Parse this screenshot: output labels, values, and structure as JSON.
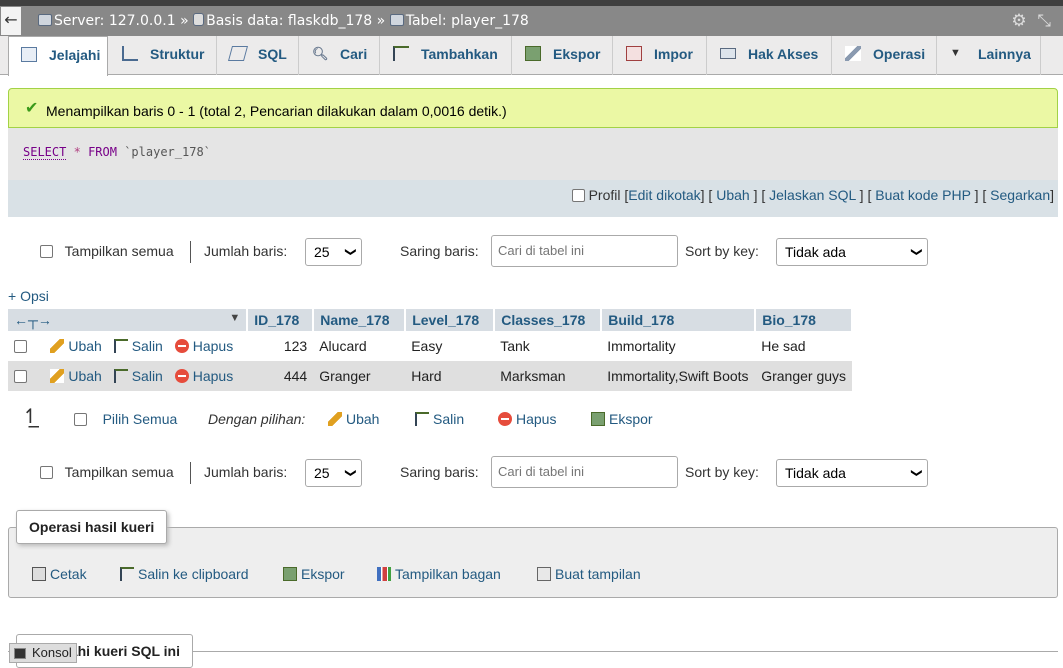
{
  "breadcrumb": {
    "server": "Server: 127.0.0.1",
    "database": "Basis data: flaskdb_178",
    "table": "Tabel: player_178",
    "separator": "»"
  },
  "tabs": [
    {
      "label": "Jelajahi",
      "icon": "browse-icon",
      "active": true
    },
    {
      "label": "Struktur",
      "icon": "structure-icon"
    },
    {
      "label": "SQL",
      "icon": "sql-icon"
    },
    {
      "label": "Cari",
      "icon": "search-icon"
    },
    {
      "label": "Tambahkan",
      "icon": "insert-icon"
    },
    {
      "label": "Ekspor",
      "icon": "export-icon"
    },
    {
      "label": "Impor",
      "icon": "import-icon"
    },
    {
      "label": "Hak Akses",
      "icon": "privileges-icon"
    },
    {
      "label": "Operasi",
      "icon": "wrench-icon"
    },
    {
      "label": "Lainnya",
      "icon": "caret-down-icon"
    }
  ],
  "message": "Menampilkan baris 0 - 1 (total 2, Pencarian dilakukan dalam 0,0016 detik.)",
  "sql": {
    "select": "SELECT",
    "star": "*",
    "from": "FROM",
    "table": "`player_178`"
  },
  "sql_links": {
    "profil": "Profil",
    "edit_inline": "Edit dikotak",
    "ubah": "Ubah",
    "jelaskan": "Jelaskan SQL",
    "buat_kode": "Buat kode PHP",
    "segarkan": "Segarkan"
  },
  "nav": {
    "show_all": "Tampilkan semua",
    "rows_label": "Jumlah baris:",
    "rows_value": "25",
    "filter_label": "Saring baris:",
    "filter_placeholder": "Cari di tabel ini",
    "sort_label": "Sort by key:",
    "sort_value": "Tidak ada"
  },
  "opsi": "+ Opsi",
  "table": {
    "columns": [
      "ID_178",
      "Name_178",
      "Level_178",
      "Classes_178",
      "Build_178",
      "Bio_178"
    ],
    "row_actions": {
      "edit": "Ubah",
      "copy": "Salin",
      "delete": "Hapus"
    },
    "rows": [
      [
        "123",
        "Alucard",
        "Easy",
        "Tank",
        "Immortality",
        "He sad"
      ],
      [
        "444",
        "Granger",
        "Hard",
        "Marksman",
        "Immortality,Swift Boots",
        "Granger guys"
      ]
    ]
  },
  "bulk": {
    "select_all": "Pilih Semua",
    "with_selected": "Dengan pilihan:",
    "edit": "Ubah",
    "copy": "Salin",
    "delete": "Hapus",
    "export": "Ekspor"
  },
  "query_ops": {
    "legend": "Operasi hasil kueri",
    "print": "Cetak",
    "copy_clipboard": "Salin ke clipboard",
    "export": "Ekspor",
    "chart": "Tampilkan bagan",
    "view": "Buat tampilan"
  },
  "bookmark_legend": "kahi kueri SQL ini",
  "console": "Konsol"
}
